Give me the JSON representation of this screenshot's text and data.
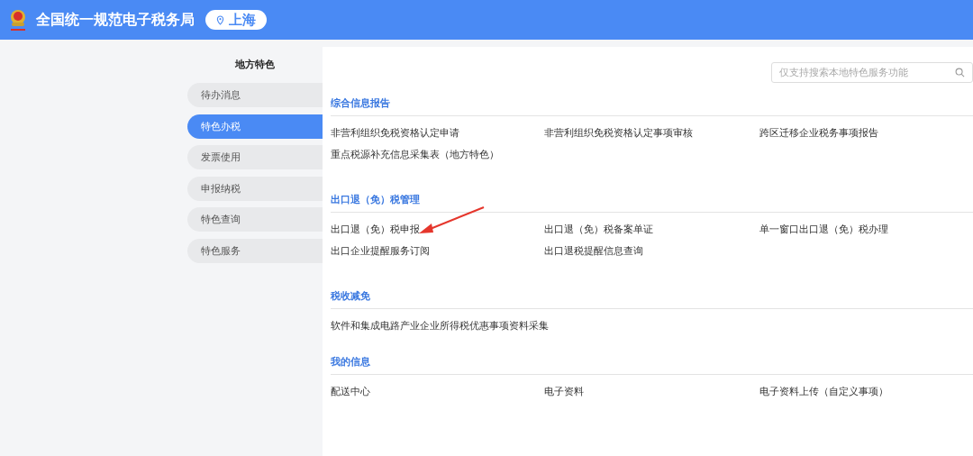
{
  "header": {
    "title": "全国统一规范电子税务局",
    "location": "上海"
  },
  "sidebar": {
    "title": "地方特色",
    "items": [
      {
        "label": "待办消息",
        "selected": false
      },
      {
        "label": "特色办税",
        "selected": true
      },
      {
        "label": "发票使用",
        "selected": false
      },
      {
        "label": "申报纳税",
        "selected": false
      },
      {
        "label": "特色查询",
        "selected": false
      },
      {
        "label": "特色服务",
        "selected": false
      }
    ]
  },
  "search": {
    "placeholder": "仅支持搜索本地特色服务功能"
  },
  "sections": [
    {
      "title": "综合信息报告",
      "items": [
        "非营利组织免税资格认定申请",
        "非营利组织免税资格认定事项审核",
        "跨区迁移企业税务事项报告",
        "重点税源补充信息采集表（地方特色）"
      ]
    },
    {
      "title": "出口退（免）税管理",
      "items": [
        "出口退（免）税申报",
        "出口退（免）税备案单证",
        "单一窗口出口退（免）税办理",
        "出口企业提醒服务订阅",
        "出口退税提醒信息查询"
      ]
    },
    {
      "title": "税收减免",
      "items": [
        "软件和集成电路产业企业所得税优惠事项资料采集"
      ]
    },
    {
      "title": "我的信息",
      "items": [
        "配送中心",
        "电子资料",
        "电子资料上传（自定义事项）"
      ]
    }
  ]
}
